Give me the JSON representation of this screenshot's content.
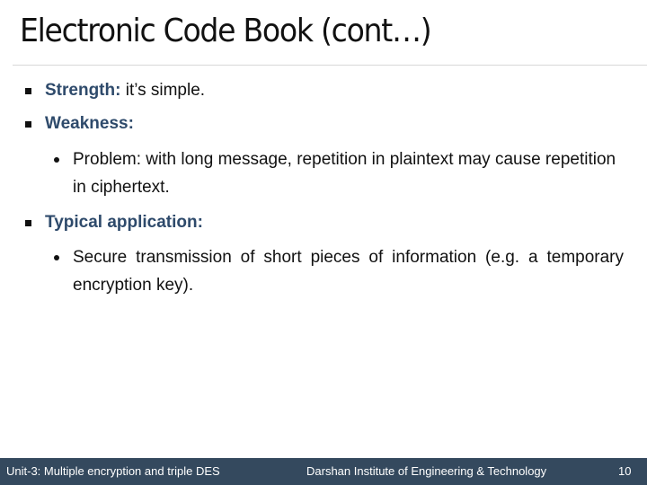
{
  "slide": {
    "title": "Electronic Code Book (cont…)",
    "bullets": [
      {
        "label": "Strength:",
        "text": " it’s simple.",
        "sub": []
      },
      {
        "label": "Weakness:",
        "text": "",
        "sub": [
          "Problem: with long message, repetition in plaintext may cause repetition in ciphertext."
        ]
      },
      {
        "label": "Typical application:",
        "text": "",
        "sub": [
          "Secure transmission of short pieces of information (e.g. a temporary encryption key)."
        ]
      }
    ]
  },
  "footer": {
    "unit": "Unit-3: Multiple encryption and triple DES",
    "institute": "Darshan Institute of Engineering & Technology",
    "page_number": "10"
  },
  "colors": {
    "accent": "#2e4a6b",
    "footer_bg": "#34495e",
    "text": "#111111"
  }
}
